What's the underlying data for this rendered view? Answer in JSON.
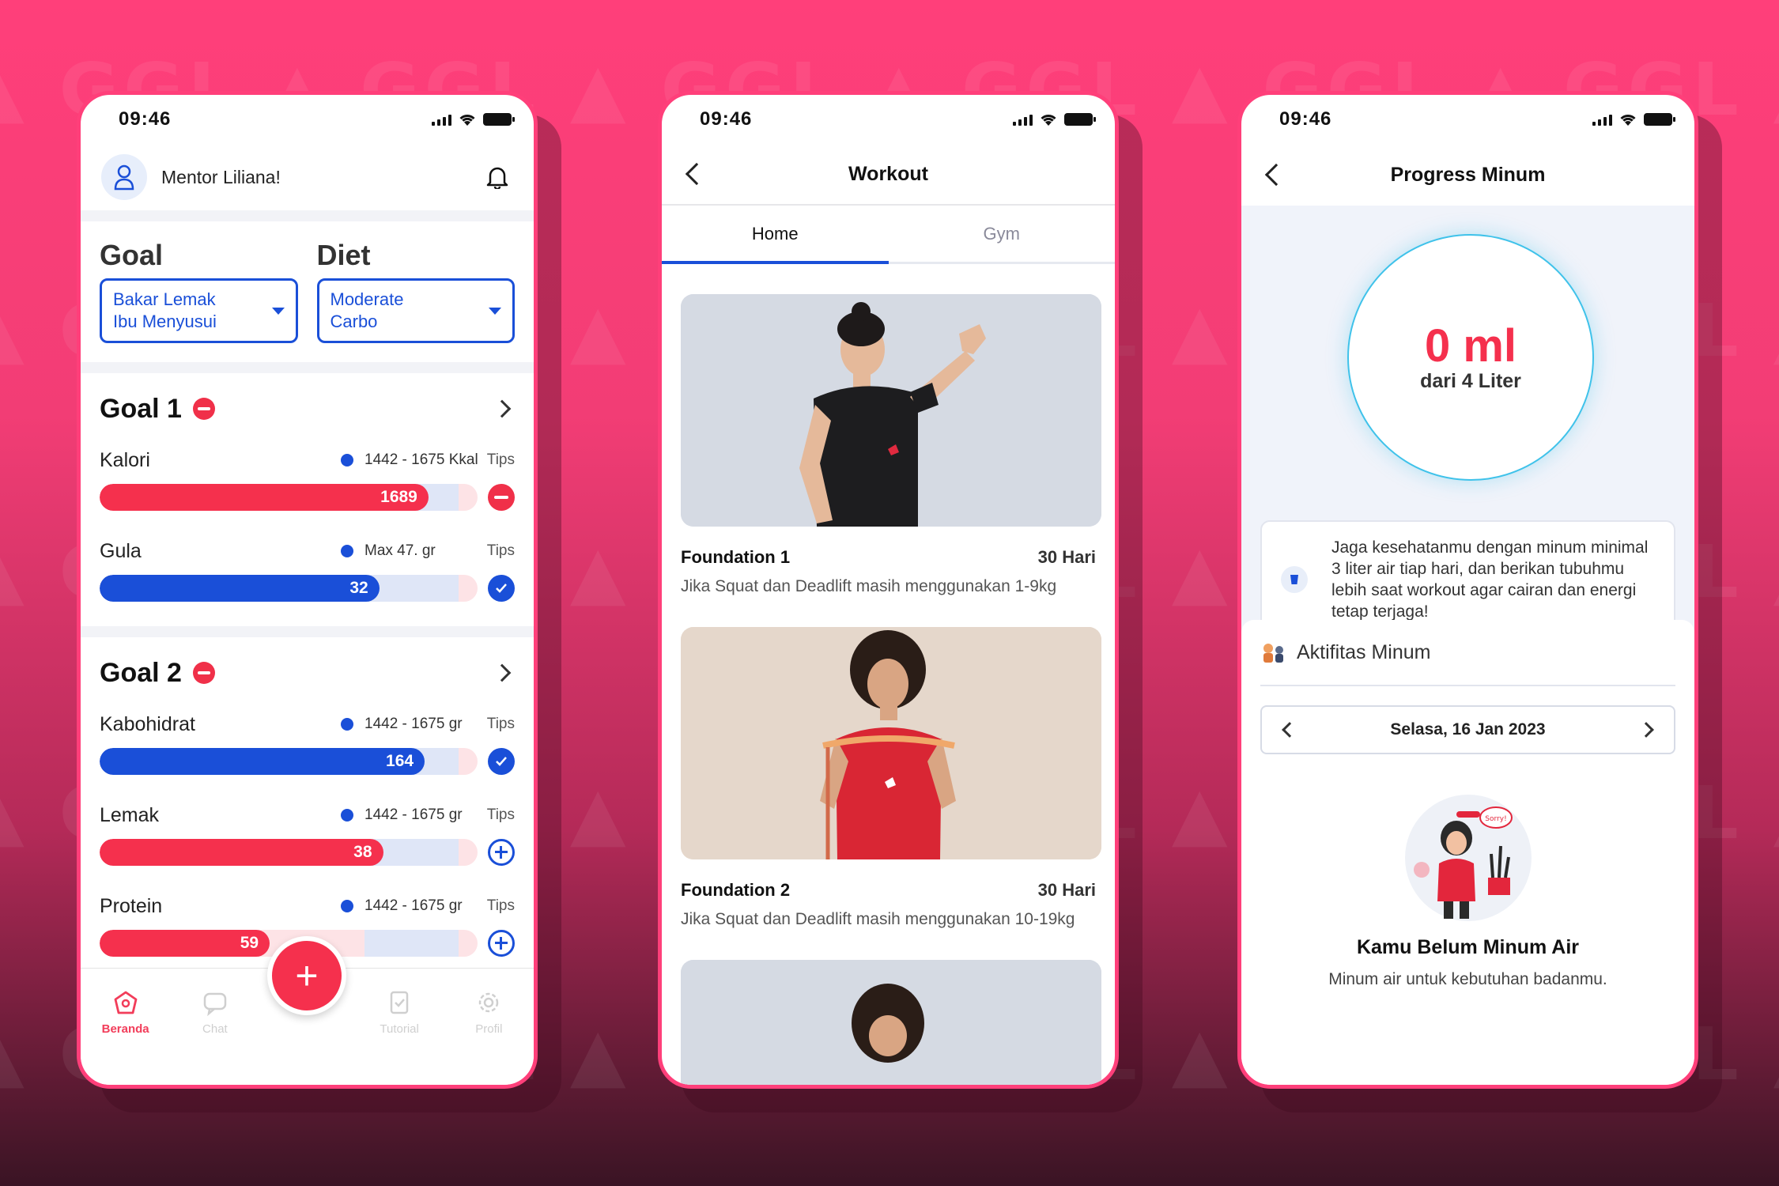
{
  "background": {
    "watermark_text": "GGL",
    "colors": {
      "top": "#ff3f7a",
      "bottom": "#3a1424",
      "accent_red": "#f5304d",
      "accent_blue": "#1a4fd8",
      "water_cyan": "#3fc2ea"
    }
  },
  "status_bar": {
    "time": "09:46"
  },
  "home": {
    "greeting": "Mentor Liliana!",
    "goal_label": "Goal",
    "diet_label": "Diet",
    "goal_select": {
      "line1": "Bakar Lemak",
      "line2": "Ibu Menyusui"
    },
    "diet_select": {
      "line1": "Moderate",
      "line2": "Carbo"
    },
    "tips_label": "Tips",
    "goals": [
      {
        "name": "Goal 1",
        "metrics": [
          {
            "name": "Kalori",
            "range": "1442 - 1675 Kkal",
            "value": "1689",
            "value_num": 1689,
            "fill_fraction": 0.87,
            "color": "red",
            "status": "over"
          },
          {
            "name": "Gula",
            "range": "Max 47. gr",
            "value": "32",
            "value_num": 32,
            "fill_fraction": 0.74,
            "color": "blue",
            "status": "ok"
          }
        ]
      },
      {
        "name": "Goal 2",
        "metrics": [
          {
            "name": "Kabohidrat",
            "range": "1442 - 1675 gr",
            "value": "164",
            "value_num": 164,
            "fill_fraction": 0.86,
            "color": "blue",
            "status": "ok"
          },
          {
            "name": "Lemak",
            "range": "1442 - 1675 gr",
            "value": "38",
            "value_num": 38,
            "fill_fraction": 0.75,
            "color": "red",
            "status": "add"
          },
          {
            "name": "Protein",
            "range": "1442 - 1675 gr",
            "value": "59",
            "value_num": 59,
            "fill_fraction": 0.45,
            "color": "red",
            "status": "add"
          }
        ]
      }
    ],
    "nav": [
      {
        "label": "Beranda",
        "icon": "home-icon",
        "active": true
      },
      {
        "label": "Chat",
        "icon": "chat-icon",
        "active": false
      },
      {
        "label": "Tutorial",
        "icon": "tutorial-icon",
        "active": false
      },
      {
        "label": "Profil",
        "icon": "settings-icon",
        "active": false
      }
    ],
    "fab_symbol": "+"
  },
  "workout": {
    "title": "Workout",
    "tabs": [
      {
        "label": "Home",
        "active": true
      },
      {
        "label": "Gym",
        "active": false
      }
    ],
    "items": [
      {
        "name": "Foundation 1",
        "duration": "30 Hari",
        "description": "Jika Squat dan Deadlift masih menggunakan 1-9kg"
      },
      {
        "name": "Foundation 2",
        "duration": "30 Hari",
        "description": "Jika Squat dan Deadlift masih menggunakan 10-19kg"
      }
    ]
  },
  "progress": {
    "title": "Progress Minum",
    "amount": "0 ml",
    "target": "dari 4 Liter",
    "tip": "Jaga kesehatanmu dengan minum minimal 3 liter air tiap hari, dan berikan tubuhmu lebih saat workout agar cairan dan energi tetap terjaga!",
    "activity_label": "Aktifitas Minum",
    "date": "Selasa, 16 Jan 2023",
    "empty_title": "Kamu Belum Minum Air",
    "empty_subtitle": "Minum air untuk kebutuhan badanmu.",
    "illustration_badge": "Sorry!"
  }
}
